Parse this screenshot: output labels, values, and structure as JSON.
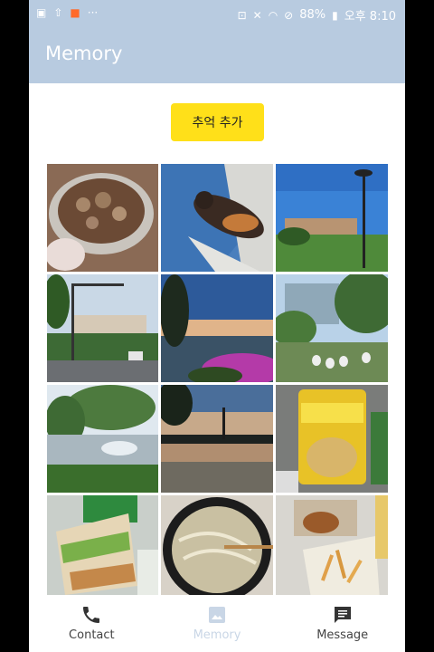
{
  "statusbar": {
    "battery": "88%",
    "time": "오후 8:10"
  },
  "appbar": {
    "title": "Memory"
  },
  "add_button": {
    "label": "추억 추가"
  },
  "photos": [
    {
      "name": "photo-grilled-mushrooms"
    },
    {
      "name": "photo-cat-on-pavement"
    },
    {
      "name": "photo-campus-lamp-post"
    },
    {
      "name": "photo-street-traffic-light"
    },
    {
      "name": "photo-sunset-lake-flowers"
    },
    {
      "name": "photo-park-geese"
    },
    {
      "name": "photo-pond-fountain"
    },
    {
      "name": "photo-lake-sunset-reflection"
    },
    {
      "name": "photo-honey-butter-almond"
    },
    {
      "name": "photo-sandwich"
    },
    {
      "name": "photo-noodle-soup"
    },
    {
      "name": "photo-fries-tray"
    }
  ],
  "bottom_nav": {
    "items": [
      {
        "label": "Contact",
        "icon": "phone-icon"
      },
      {
        "label": "Memory",
        "icon": "image-icon"
      },
      {
        "label": "Message",
        "icon": "message-icon"
      }
    ]
  },
  "colors": {
    "appbar": "#b8cbe0",
    "button": "#ffe019",
    "nav_active": "#c9d6e6"
  }
}
